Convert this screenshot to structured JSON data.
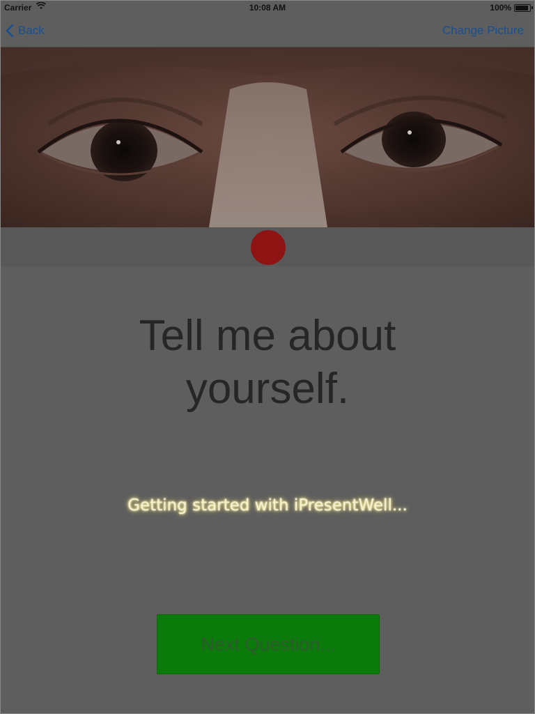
{
  "status_bar": {
    "carrier": "Carrier",
    "time": "10:08 AM",
    "battery_percent": "100%",
    "battery_level": 1.0,
    "wifi_icon": "wifi-icon"
  },
  "nav_bar": {
    "back_label": "Back",
    "back_icon": "chevron-left-icon",
    "change_picture_label": "Change Picture",
    "accent_color": "#1a4f8f"
  },
  "photo": {
    "subject": "eyes-photo"
  },
  "record": {
    "color": "#8e1414",
    "icon": "record-icon"
  },
  "main": {
    "question_line1": "Tell me about",
    "question_line2": "yourself.",
    "loading_text": "Getting started with iPresentWell...",
    "next_button_label": "Next Question...",
    "next_button_color": "#0a7a0a"
  }
}
